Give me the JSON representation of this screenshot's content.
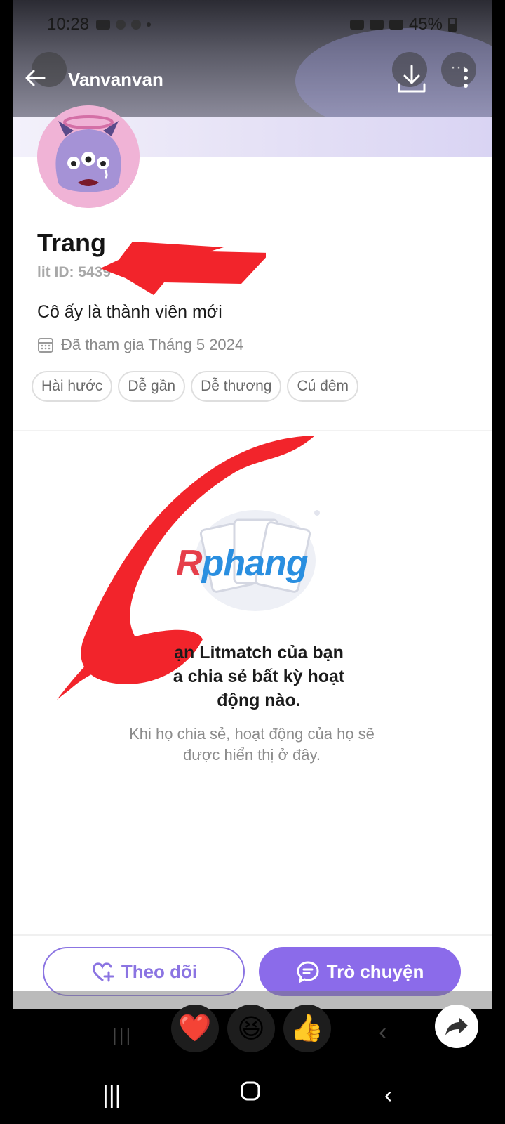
{
  "status_bar": {
    "time": "10:28",
    "battery": "45%"
  },
  "header": {
    "title": "Vanvanvan"
  },
  "profile": {
    "name": "Trang",
    "lit_id": "lit ID: 5439",
    "bio": "Cô ấy là thành viên mới",
    "joined": "Đã tham gia Tháng 5 2024",
    "tags": [
      "Hài hước",
      "Dễ gần",
      "Dễ thương",
      "Cú đêm"
    ]
  },
  "watermark": {
    "part1": "R",
    "part2": "phang"
  },
  "empty_state": {
    "title": "ạn Litmatch của bạn\na chia sẻ bất kỳ hoạt\nđộng nào.",
    "subtitle": "Khi họ chia sẻ, hoạt động của họ sẽ được hiển thị ở đây."
  },
  "actions": {
    "follow_label": "Theo dõi",
    "chat_label": "Trò chuyện"
  },
  "reactions": [
    "heart",
    "laughing-face",
    "thumbs-up"
  ],
  "colors": {
    "accent": "#8b6bea",
    "redaction": "#f2242b"
  }
}
